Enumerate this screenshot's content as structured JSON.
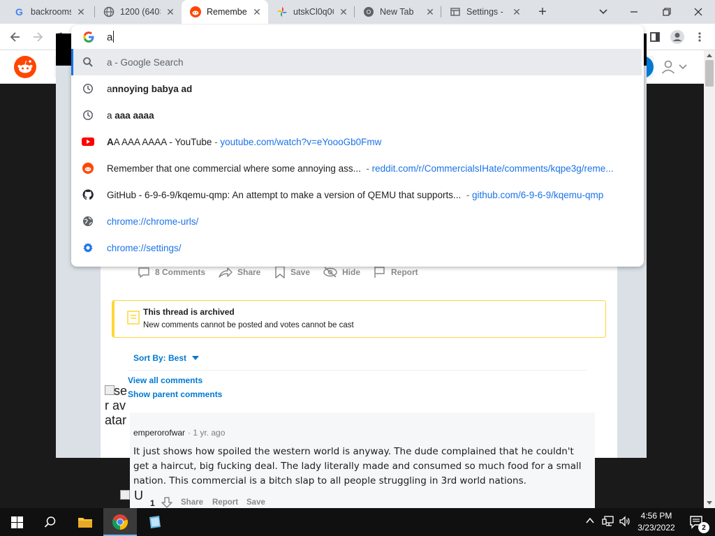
{
  "tabs": [
    {
      "title": "backrooms",
      "favicon": "google-icon"
    },
    {
      "title": "1200 (640×",
      "favicon": "globe-icon"
    },
    {
      "title": "Remember",
      "favicon": "reddit-icon",
      "active": true
    },
    {
      "title": "utskCl0q0C",
      "favicon": "google-photos-icon"
    },
    {
      "title": "New Tab",
      "favicon": "chrome-icon"
    },
    {
      "title": "Settings - ",
      "favicon": "settings-page-icon"
    }
  ],
  "omnibox": {
    "value": "a",
    "suggestions": [
      {
        "icon": "search-icon",
        "text": "a - Google Search"
      },
      {
        "icon": "history-icon",
        "match": "a",
        "rest": "nnoying babya ad"
      },
      {
        "icon": "history-icon",
        "match": "a",
        "rest": " aaa aaaa"
      },
      {
        "icon": "youtube-icon",
        "match": "A",
        "rest": "A AAA AAAA - YouTube",
        "url": "youtube.com/watch?v=eYoooGb0Fmw"
      },
      {
        "icon": "reddit-icon",
        "text": "Remember that one commercial where some annoying ass...",
        "url": "reddit.com/r/CommercialsIHate/comments/kqpe3g/reme..."
      },
      {
        "icon": "github-icon",
        "text": "GitHub - 6-9-6-9/kqemu-qmp: An attempt to make a version of QEMU that supports...",
        "url": "github.com/6-9-6-9/kqemu-qmp"
      },
      {
        "icon": "globe-icon",
        "url": "chrome://chrome-urls/"
      },
      {
        "icon": "gear-icon",
        "url": "chrome://settings/"
      }
    ]
  },
  "post": {
    "actions": [
      {
        "label": "8 Comments",
        "icon": "comment-icon"
      },
      {
        "label": "Share",
        "icon": "share-icon"
      },
      {
        "label": "Save",
        "icon": "bookmark-icon"
      },
      {
        "label": "Hide",
        "icon": "hide-icon"
      },
      {
        "label": "Report",
        "icon": "flag-icon"
      }
    ],
    "archived_title": "This thread is archived",
    "archived_text": "New comments cannot be posted and votes cannot be cast",
    "sort_label": "Sort By: Best",
    "view_all": "View all comments",
    "show_parent": "Show parent comments",
    "avatar_alt": "User avatar"
  },
  "comment": {
    "author": "emperorofwar",
    "time": "· 1 yr. ago",
    "body": "It just shows how spoiled the western world is anyway. The dude complained that he couldn't get a haircut, big fucking deal. The lady literally made and consumed so much food for a small nation. This commercial is a bitch slap to all people struggling in 3rd world nations.",
    "votes": "1",
    "share": "Share",
    "report": "Report",
    "save": "Save",
    "alt_fragment": "U"
  },
  "taskbar": {
    "time": "4:56 PM",
    "date": "3/23/2022",
    "notification_count": "2"
  },
  "colors": {
    "reddit_orange": "#ff4500",
    "link_blue": "#1a73e8",
    "archive_yellow": "#ffd635",
    "reddit_blue": "#0079d3"
  }
}
